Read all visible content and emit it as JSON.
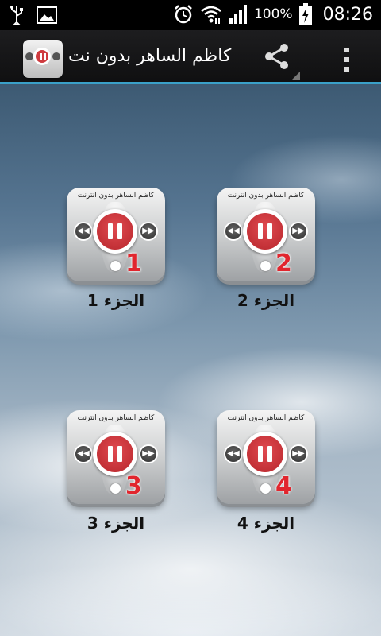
{
  "status_bar": {
    "battery_percent": "100%",
    "time": "08:26",
    "icons": [
      "usb-icon",
      "image-icon",
      "alarm-icon",
      "wifi-icon",
      "signal-icon",
      "battery-charging-icon"
    ]
  },
  "action_bar": {
    "title": "كاظم الساهر بدون نت",
    "icons": [
      "app-icon",
      "share-icon",
      "overflow-menu-icon"
    ],
    "accent_color": "#3aa0c8"
  },
  "tiles": [
    {
      "caption": "كاظم الساهر بدون انترنت",
      "number": "1",
      "label": "الجزء 1"
    },
    {
      "caption": "كاظم الساهر بدون انترنت",
      "number": "2",
      "label": "الجزء 2"
    },
    {
      "caption": "كاظم الساهر بدون انترنت",
      "number": "3",
      "label": "الجزء 3"
    },
    {
      "caption": "كاظم الساهر بدون انترنت",
      "number": "4",
      "label": "الجزء 4"
    }
  ],
  "colors": {
    "play_button": "#cf3b3f",
    "number_text": "#e1262e"
  }
}
